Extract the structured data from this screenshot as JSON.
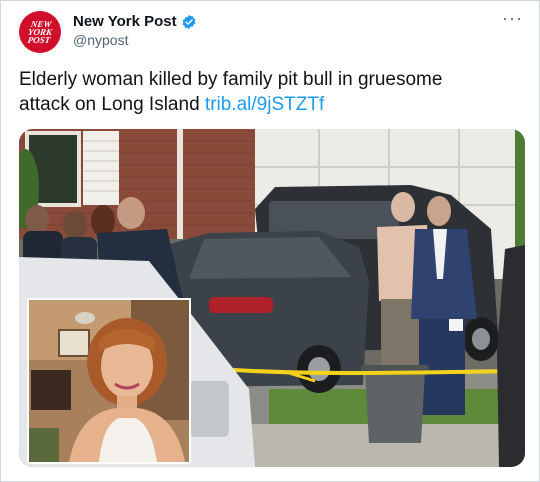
{
  "tweet": {
    "avatar_text": [
      "NEW",
      "YORK",
      "POST"
    ],
    "display_name": "New York Post",
    "handle": "@nypost",
    "more_label": "···",
    "text": "Elderly woman killed by family pit bull in gruesome attack on Long Island",
    "link": "trib.al/9jSTZTf"
  },
  "colors": {
    "brand_red": "#d0102a",
    "verified_blue": "#1d9bf0",
    "link_blue": "#1d9bf0",
    "handle_gray": "#536471"
  },
  "icons": {
    "verified": "verified-badge-icon",
    "more": "more-horizontal-icon"
  }
}
